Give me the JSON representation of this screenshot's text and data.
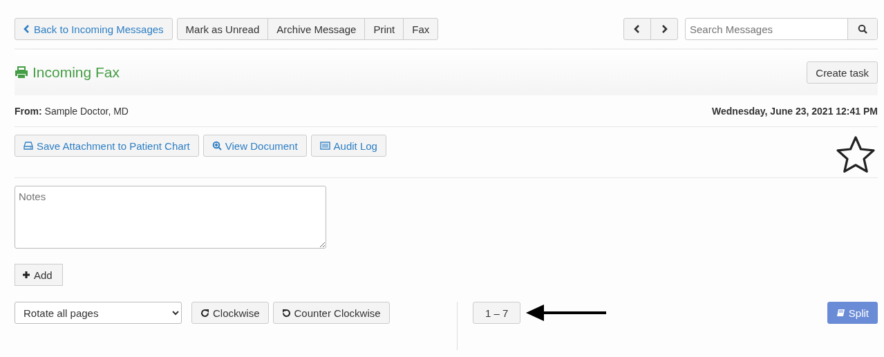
{
  "toolbar": {
    "back": "Back to Incoming Messages",
    "actions": [
      "Mark as Unread",
      "Archive Message",
      "Print",
      "Fax"
    ],
    "search": {
      "placeholder": "Search Messages"
    }
  },
  "header": {
    "title": "Incoming Fax",
    "create_task": "Create task"
  },
  "message": {
    "from_label": "From:",
    "from": "Sample Doctor, MD",
    "date": "Wednesday, June 23, 2021 12:41 PM",
    "starred": false
  },
  "actions": [
    {
      "kind": "save",
      "label": "Save Attachment to Patient Chart"
    },
    {
      "kind": "view",
      "label": "View Document"
    },
    {
      "kind": "audit",
      "label": "Audit Log"
    }
  ],
  "notes": {
    "placeholder": "Notes",
    "add": "Add"
  },
  "pages": {
    "rotate_select": "Rotate all pages",
    "clockwise": "Clockwise",
    "counter_clockwise": "Counter Clockwise",
    "range": "1 – 7",
    "split": "Split"
  }
}
